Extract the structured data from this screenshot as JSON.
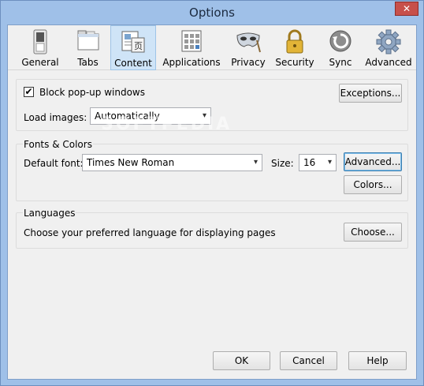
{
  "window": {
    "title": "Options",
    "close_glyph": "✕"
  },
  "toolbar": {
    "items": [
      {
        "label": "General",
        "icon": "switch-icon"
      },
      {
        "label": "Tabs",
        "icon": "tabs-icon"
      },
      {
        "label": "Content",
        "icon": "content-icon",
        "active": true
      },
      {
        "label": "Applications",
        "icon": "applications-icon"
      },
      {
        "label": "Privacy",
        "icon": "mask-icon"
      },
      {
        "label": "Security",
        "icon": "padlock-icon"
      },
      {
        "label": "Sync",
        "icon": "sync-icon"
      },
      {
        "label": "Advanced",
        "icon": "gear-icon"
      }
    ]
  },
  "content": {
    "block_popups": {
      "label": "Block pop-up windows",
      "checked": true
    },
    "exceptions_button": "Exceptions...",
    "load_images": {
      "label": "Load images:",
      "value": "Automatically"
    },
    "watermark": "SOFTPEDIA"
  },
  "fonts": {
    "legend": "Fonts & Colors",
    "default_font_label": "Default font:",
    "default_font_value": "Times New Roman",
    "size_label": "Size:",
    "size_value": "16",
    "advanced_button": "Advanced...",
    "colors_button": "Colors..."
  },
  "languages": {
    "legend": "Languages",
    "description": "Choose your preferred language for displaying pages",
    "choose_button": "Choose..."
  },
  "footer": {
    "ok": "OK",
    "cancel": "Cancel",
    "help": "Help"
  },
  "colors": {
    "titlebar": "#9fc0e8",
    "active_tab": "#cfe4f7",
    "focus": "#3c7fb1"
  }
}
